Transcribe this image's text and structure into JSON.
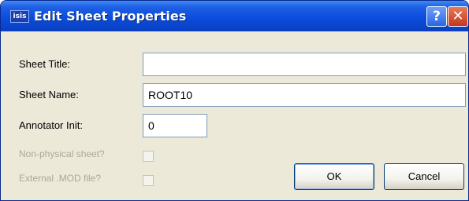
{
  "window": {
    "title": "Edit Sheet Properties",
    "app_icon_text": "isis",
    "help_glyph": "?",
    "close_glyph": "✕"
  },
  "fields": {
    "sheet_title": {
      "label": "Sheet Title:",
      "value": ""
    },
    "sheet_name": {
      "label": "Sheet Name:",
      "value": "ROOT10"
    },
    "annotator_init": {
      "label": "Annotator Init:",
      "value": "0"
    }
  },
  "options": {
    "non_physical": {
      "label": "Non-physical sheet?",
      "checked": false,
      "enabled": false
    },
    "external_mod": {
      "label": "External .MOD file?",
      "checked": false,
      "enabled": false
    }
  },
  "buttons": {
    "ok": "OK",
    "cancel": "Cancel"
  },
  "colors": {
    "titlebar": "#0b4ddc",
    "dialog_bg": "#ece9d8",
    "close_button": "#c6361a",
    "disabled_text": "#aca899"
  }
}
